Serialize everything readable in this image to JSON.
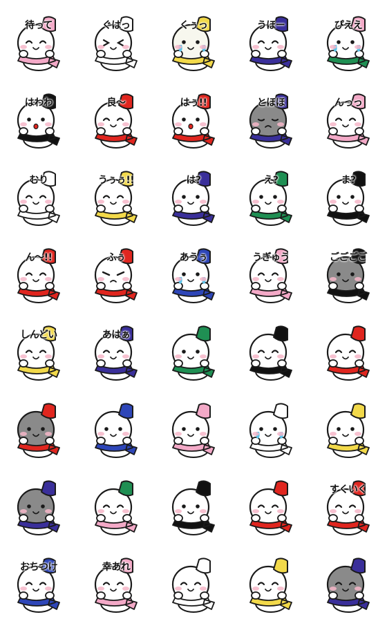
{
  "stickers": [
    {
      "caption": "待って",
      "hat": "#f3a9c7",
      "scarf": "#f3a9c7",
      "face": "#ffffff",
      "expr": "happy",
      "icon": "snowman-icon"
    },
    {
      "caption": "ぐはっ",
      "hat": "#ffffff",
      "scarf": "#ffffff",
      "face": "#ffffff",
      "expr": "hurt",
      "icon": "snowman-icon"
    },
    {
      "caption": "くぅっ",
      "hat": "#f2d94a",
      "scarf": "#f2d94a",
      "face": "#f7f7ee",
      "expr": "cry",
      "icon": "snowman-icon"
    },
    {
      "caption": "うほー",
      "hat": "#3a2f9a",
      "scarf": "#3a2f9a",
      "face": "#ffffff",
      "expr": "happy",
      "icon": "snowman-icon"
    },
    {
      "caption": "ぴええ",
      "hat": "#f3a9c7",
      "scarf": "#1f8f53",
      "face": "#ffffff",
      "expr": "cry",
      "icon": "snowman-icon"
    },
    {
      "caption": "はわわ",
      "hat": "#111111",
      "scarf": "#111111",
      "face": "#ffffff",
      "expr": "surprised",
      "icon": "snowman-icon"
    },
    {
      "caption": "良～",
      "hat": "#e0261f",
      "scarf": "#e0261f",
      "face": "#ffffff",
      "expr": "happy",
      "icon": "snowman-icon"
    },
    {
      "caption": "はぅ!!",
      "hat": "#e0261f",
      "scarf": "#e0261f",
      "face": "#ffffff",
      "expr": "surprised",
      "icon": "snowman-icon"
    },
    {
      "caption": "とほほ",
      "hat": "#3a2f9a",
      "scarf": "#3a2f9a",
      "face": "#8a8a8a",
      "expr": "sad",
      "icon": "snowman-icon"
    },
    {
      "caption": "んっっ",
      "hat": "#f3a9c7",
      "scarf": "#f3a9c7",
      "face": "#ffffff",
      "expr": "closed",
      "icon": "snowman-icon"
    },
    {
      "caption": "むり",
      "hat": "#ffffff",
      "scarf": "#ffffff",
      "face": "#ffffff",
      "expr": "closed",
      "icon": "snowman-icon"
    },
    {
      "caption": "うぅぅ!!",
      "hat": "#f2d94a",
      "scarf": "#f2d94a",
      "face": "#ffffff",
      "expr": "closed",
      "icon": "snowman-icon"
    },
    {
      "caption": "は?",
      "hat": "#3a2f9a",
      "scarf": "#3a2f9a",
      "face": "#ffffff",
      "expr": "neutral",
      "icon": "snowman-icon"
    },
    {
      "caption": "え?",
      "hat": "#1f8f53",
      "scarf": "#1f8f53",
      "face": "#ffffff",
      "expr": "neutral",
      "icon": "snowman-icon"
    },
    {
      "caption": "ま?",
      "hat": "#111111",
      "scarf": "#111111",
      "face": "#ffffff",
      "expr": "neutral",
      "icon": "snowman-icon"
    },
    {
      "caption": "ん～!!",
      "hat": "#e0261f",
      "scarf": "#e0261f",
      "face": "#ffffff",
      "expr": "closed",
      "icon": "snowman-icon"
    },
    {
      "caption": "ふぅ",
      "hat": "#e0261f",
      "scarf": "#e0261f",
      "face": "#ffffff",
      "expr": "angry",
      "icon": "snowman-icon"
    },
    {
      "caption": "あうぅ",
      "hat": "#2e46b8",
      "scarf": "#2e46b8",
      "face": "#ffffff",
      "expr": "cry",
      "icon": "snowman-icon"
    },
    {
      "caption": "うぎゅう",
      "hat": "#f3a9c7",
      "scarf": "#f3a9c7",
      "face": "#ffffff",
      "expr": "closed",
      "icon": "snowman-icon"
    },
    {
      "caption": "ごごごご",
      "hat": "#111111",
      "scarf": "#111111",
      "face": "#8a8a8a",
      "expr": "neutral",
      "icon": "snowman-icon"
    },
    {
      "caption": "しんどい",
      "hat": "#f2d94a",
      "scarf": "#f2d94a",
      "face": "#ffffff",
      "expr": "closed",
      "icon": "snowman-icon"
    },
    {
      "caption": "あはぁ",
      "hat": "#3a2f9a",
      "scarf": "#3a2f9a",
      "face": "#ffffff",
      "expr": "happy",
      "icon": "snowman-icon"
    },
    {
      "caption": "",
      "hat": "#1f8f53",
      "scarf": "#1f8f53",
      "face": "#ffffff",
      "expr": "neutral",
      "icon": "snowman-icon"
    },
    {
      "caption": "",
      "hat": "#111111",
      "scarf": "#111111",
      "face": "#ffffff",
      "expr": "closed",
      "icon": "snowman-icon"
    },
    {
      "caption": "",
      "hat": "#e0261f",
      "scarf": "#e0261f",
      "face": "#ffffff",
      "expr": "closed",
      "icon": "snowman-icon"
    },
    {
      "caption": "",
      "hat": "#e0261f",
      "scarf": "#e0261f",
      "face": "#8a8a8a",
      "expr": "neutral",
      "icon": "snowman-icon"
    },
    {
      "caption": "",
      "hat": "#2e46b8",
      "scarf": "#2e46b8",
      "face": "#ffffff",
      "expr": "neutral",
      "icon": "snowman-icon"
    },
    {
      "caption": "",
      "hat": "#f3a9c7",
      "scarf": "#f3a9c7",
      "face": "#ffffff",
      "expr": "neutral",
      "icon": "snowman-icon"
    },
    {
      "caption": "",
      "hat": "#ffffff",
      "scarf": "#ffffff",
      "face": "#ffffff",
      "expr": "cry",
      "icon": "snowman-icon"
    },
    {
      "caption": "",
      "hat": "#f2d94a",
      "scarf": "#f2d94a",
      "face": "#ffffff",
      "expr": "neutral",
      "icon": "snowman-icon"
    },
    {
      "caption": "",
      "hat": "#3a2f9a",
      "scarf": "#3a2f9a",
      "face": "#8a8a8a",
      "expr": "neutral",
      "icon": "snowman-icon"
    },
    {
      "caption": "",
      "hat": "#1f8f53",
      "scarf": "#f3a9c7",
      "face": "#ffffff",
      "expr": "happy",
      "icon": "snowman-icon"
    },
    {
      "caption": "",
      "hat": "#111111",
      "scarf": "#111111",
      "face": "#ffffff",
      "expr": "neutral",
      "icon": "snowman-icon"
    },
    {
      "caption": "",
      "hat": "#e0261f",
      "scarf": "#e0261f",
      "face": "#ffffff",
      "expr": "closed",
      "icon": "snowman-icon"
    },
    {
      "caption": "すくいく",
      "hat": "#e0261f",
      "scarf": "#e0261f",
      "face": "#ffffff",
      "expr": "closed",
      "icon": "snowman-icon"
    },
    {
      "caption": "おちつけ",
      "hat": "#2e46b8",
      "scarf": "#2e46b8",
      "face": "#ffffff",
      "expr": "closed",
      "icon": "snowman-icon"
    },
    {
      "caption": "幸あれ",
      "hat": "#f3a9c7",
      "scarf": "#f3a9c7",
      "face": "#ffffff",
      "expr": "closed",
      "icon": "snowman-icon"
    },
    {
      "caption": "",
      "hat": "#ffffff",
      "scarf": "#ffffff",
      "face": "#ffffff",
      "expr": "closed",
      "icon": "snowman-icon"
    },
    {
      "caption": "",
      "hat": "#f2d94a",
      "scarf": "#f2d94a",
      "face": "#ffffff",
      "expr": "closed",
      "icon": "snowman-icon"
    },
    {
      "caption": "",
      "hat": "#3a2f9a",
      "scarf": "#3a2f9a",
      "face": "#8a8a8a",
      "expr": "closed",
      "icon": "snowman-icon"
    }
  ]
}
